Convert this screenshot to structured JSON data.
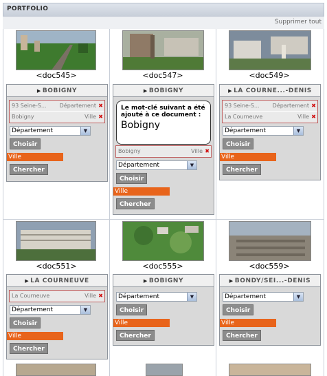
{
  "header": {
    "title": "PORTFOLIO",
    "delete_all": "Supprimer tout"
  },
  "cells": [
    {
      "doc": "<doc545>",
      "keyword_title": "BOBIGNY",
      "keywords": [
        {
          "label": "93 Seine-S...",
          "type": "Département"
        },
        {
          "label": "Bobigny",
          "type": "Ville"
        }
      ],
      "select": "Département",
      "choose": "Choisir",
      "ville": "Ville",
      "search": "Chercher"
    },
    {
      "doc": "<doc547>",
      "keyword_title": "BOBIGNY",
      "tooltip_text": "Le mot-clé suivant a été ajouté à ce document :",
      "tooltip_keyword": "Bobigny",
      "keywords": [
        {
          "label": "Bobigny",
          "type": "Ville"
        }
      ],
      "select": "Département",
      "choose": "Choisir",
      "ville": "Ville",
      "search": "Chercher"
    },
    {
      "doc": "<doc549>",
      "keyword_title": "LA COURNE...-DENIS",
      "keywords": [
        {
          "label": "93 Seine-S...",
          "type": "Département"
        },
        {
          "label": "La Courneuve",
          "type": "Ville"
        }
      ],
      "select": "Département",
      "choose": "Choisir",
      "ville": "Ville",
      "search": "Chercher"
    },
    {
      "doc": "<doc551>",
      "keyword_title": "LA COURNEUVE",
      "keywords": [
        {
          "label": "La Courneuve",
          "type": "Ville"
        }
      ],
      "select": "Département",
      "choose": "Choisir",
      "ville": "Ville",
      "search": "Chercher"
    },
    {
      "doc": "<doc555>",
      "keyword_title": "BOBIGNY",
      "keywords": [],
      "select": "Département",
      "choose": "Choisir",
      "ville": "Ville",
      "search": "Chercher"
    },
    {
      "doc": "<doc559>",
      "keyword_title": "BONDY/SEI...-DENIS",
      "keywords": [],
      "select": "Département",
      "choose": "Choisir",
      "ville": "Ville",
      "search": "Chercher"
    }
  ],
  "colors": {
    "accent": "#e8641b",
    "delete": "#d01010",
    "button": "#8c8c8c"
  }
}
